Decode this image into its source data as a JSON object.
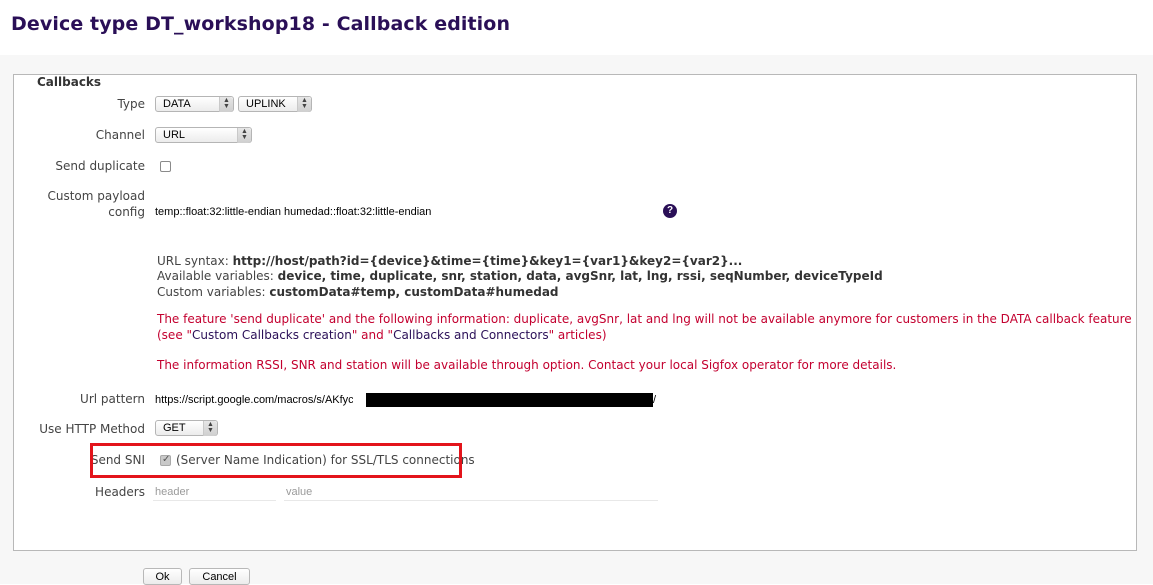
{
  "page": {
    "title": "Device type DT_workshop18 - Callback edition"
  },
  "form": {
    "legend": "Callbacks",
    "type": {
      "label": "Type",
      "value1": "DATA",
      "value2": "UPLINK"
    },
    "channel": {
      "label": "Channel",
      "value": "URL"
    },
    "send_duplicate": {
      "label": "Send duplicate",
      "checked": false
    },
    "custom_payload": {
      "label_line1": "Custom payload",
      "label_line2": "config",
      "value": "temp::float:32:little-endian humedad::float:32:little-endian",
      "help_icon": "question-circle-icon",
      "help_glyph": "?"
    },
    "url_syntax": {
      "label": "URL syntax:",
      "value": "http://host/path?id={device}&time={time}&key1={var1}&key2={var2}..."
    },
    "available_vars": {
      "label": "Available variables:",
      "value": "device, time, duplicate, snr, station, data, avgSnr, lat, lng, rssi, seqNumber, deviceTypeId"
    },
    "custom_vars": {
      "label": "Custom variables:",
      "value": "customData#temp, customData#humedad"
    },
    "warning1": {
      "text_before": "The feature 'send duplicate' and the following information: duplicate, avgSnr, lat and lng will not be available anymore for customers in the DATA callback feature (see \"",
      "link1": "Custom Callbacks creation",
      "text_mid": "\" and \"",
      "link2": "Callbacks and Connectors",
      "text_after": "\" articles)"
    },
    "warning2": "The information RSSI, SNR and station will be available through option. Contact your local Sigfox operator for more details.",
    "url_pattern": {
      "label": "Url pattern",
      "value_prefix": "https://script.google.com/macros/s/AKfycby",
      "value_suffix": "/"
    },
    "http_method": {
      "label": "Use HTTP Method",
      "value": "GET"
    },
    "send_sni": {
      "label": "Send SNI",
      "checked": true,
      "description": "(Server Name Indication) for SSL/TLS connections"
    },
    "headers": {
      "label": "Headers",
      "header_placeholder": "header",
      "value_placeholder": "value"
    }
  },
  "buttons": {
    "ok": "Ok",
    "cancel": "Cancel"
  },
  "colors": {
    "title": "#2a0f57",
    "warning": "#c3002f",
    "highlight": "#e3141b"
  }
}
